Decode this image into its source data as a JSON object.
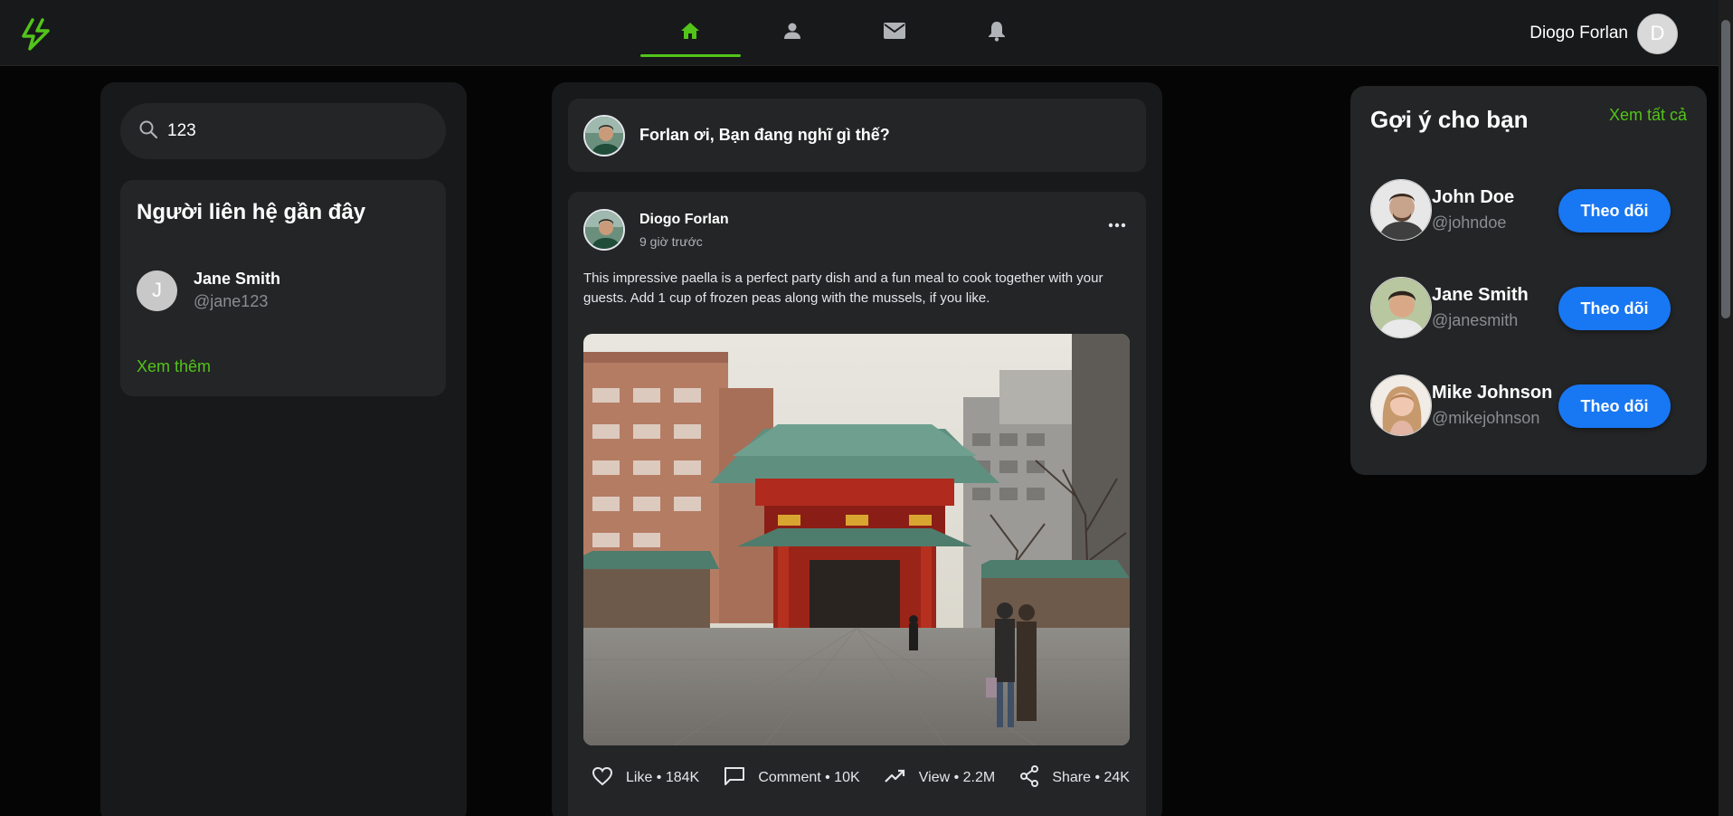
{
  "colors": {
    "accent": "#52c41a",
    "primary_button": "#1877f2",
    "background": "#050505",
    "card": "#242526",
    "panel": "#18191a"
  },
  "header": {
    "logo_icon": "lightning-bolt-icon",
    "nav": [
      {
        "name": "home",
        "icon": "home-icon",
        "active": true
      },
      {
        "name": "profile",
        "icon": "person-icon",
        "active": false
      },
      {
        "name": "messages",
        "icon": "mail-icon",
        "active": false
      },
      {
        "name": "notifications",
        "icon": "bell-icon",
        "active": false
      }
    ],
    "user_name": "Diogo Forlan",
    "user_initial": "D"
  },
  "left": {
    "search_value": "123",
    "contacts_title": "Người liên hệ gần đây",
    "contacts": [
      {
        "initial": "J",
        "name": "Jane Smith",
        "handle": "@jane123"
      }
    ],
    "see_more": "Xem thêm"
  },
  "feed": {
    "composer_prompt": "Forlan ơi, Bạn đang nghĩ gì thế?",
    "post": {
      "author": "Diogo Forlan",
      "time": "9 giờ trước",
      "body": "This impressive paella is a perfect party dish and a fun meal to cook together with your guests. Add 1 cup of frozen peas along with the mussels, if you like.",
      "actions": {
        "like": "Like • 184K",
        "comment": "Comment • 10K",
        "view": "View • 2.2M",
        "share": "Share • 24K"
      }
    }
  },
  "right": {
    "title": "Gợi ý cho bạn",
    "see_all": "Xem tất cả",
    "suggestions": [
      {
        "name": "John Doe",
        "handle": "@johndoe",
        "button": "Theo dõi"
      },
      {
        "name": "Jane Smith",
        "handle": "@janesmith",
        "button": "Theo dõi"
      },
      {
        "name": "Mike Johnson",
        "handle": "@mikejohnson",
        "button": "Theo dõi"
      }
    ]
  }
}
